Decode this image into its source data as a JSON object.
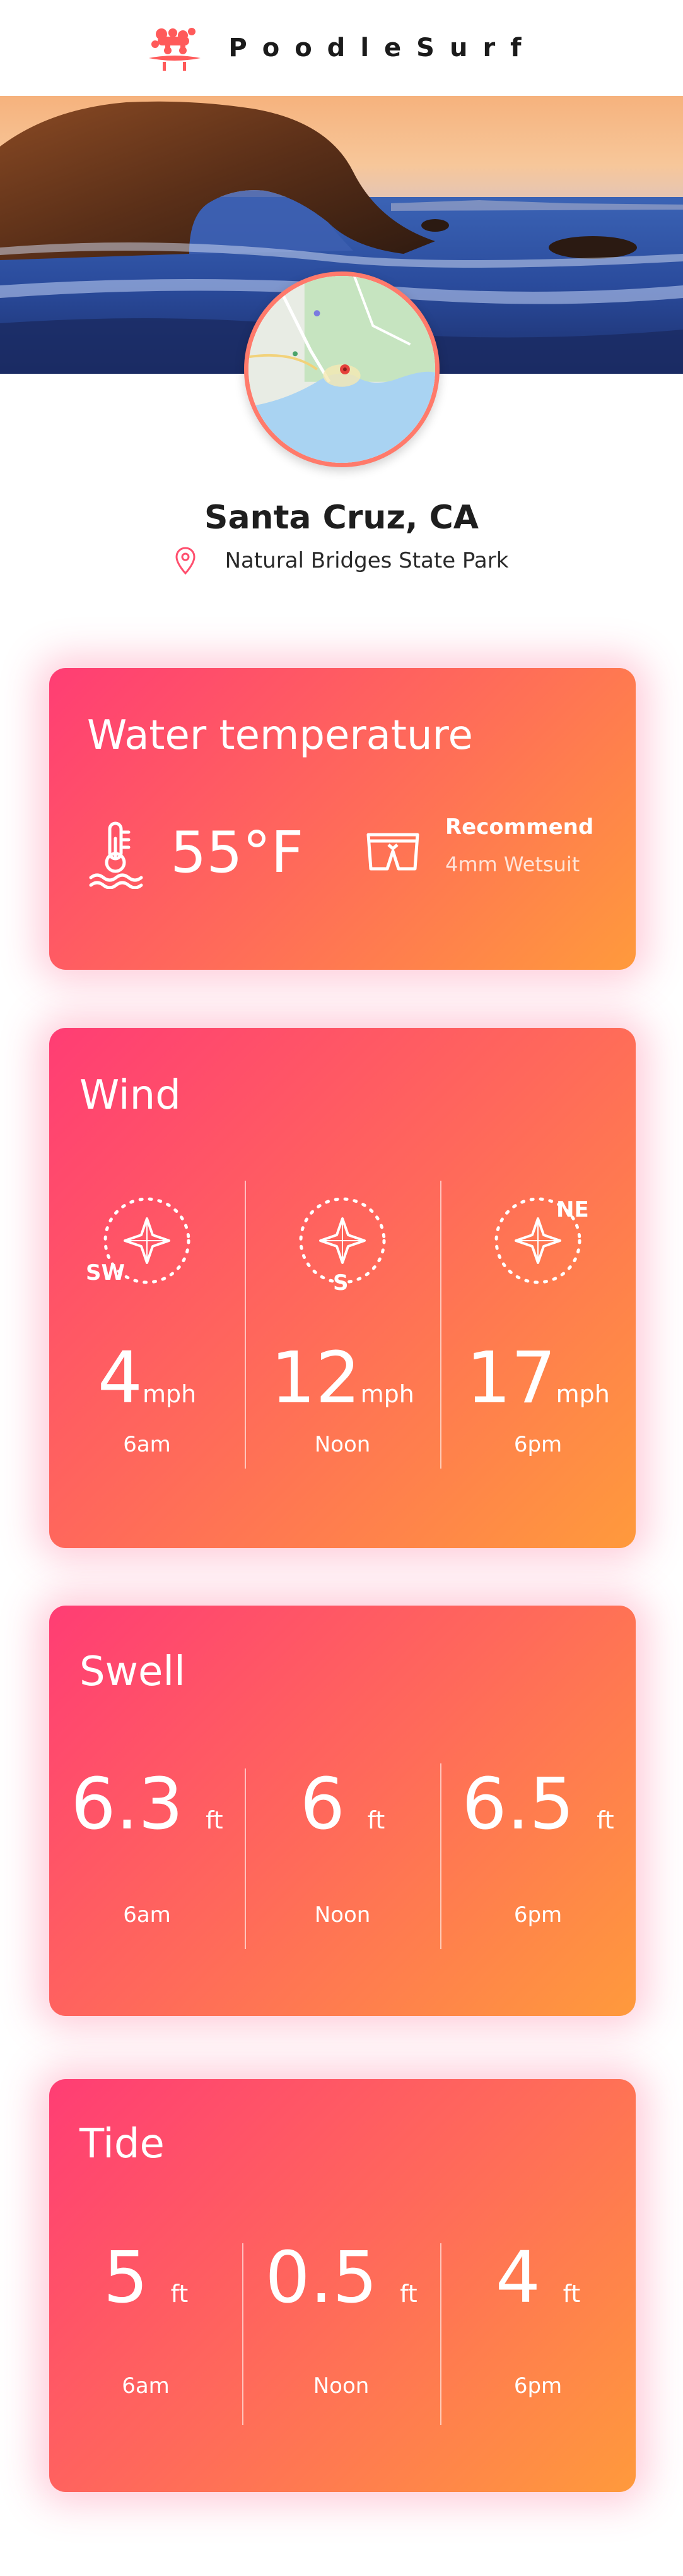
{
  "header": {
    "brand": "PoodleSurf",
    "logo_icon": "poodle-surfboard-icon"
  },
  "location": {
    "city": "Santa Cruz, CA",
    "spot": "Natural Bridges State Park",
    "pin_icon": "location-pin-icon"
  },
  "water": {
    "title": "Water temperature",
    "temperature": "55°F",
    "recommend_label": "Recommend",
    "recommend_value": "4mm Wetsuit"
  },
  "wind": {
    "title": "Wind",
    "readings": [
      {
        "direction": "SW",
        "speed": "4",
        "unit": "mph",
        "time": "6am"
      },
      {
        "direction": "S",
        "speed": "12",
        "unit": "mph",
        "time": "Noon"
      },
      {
        "direction": "NE",
        "speed": "17",
        "unit": "mph",
        "time": "6pm"
      }
    ]
  },
  "swell": {
    "title": "Swell",
    "readings": [
      {
        "height": "6.3",
        "unit": "ft",
        "time": "6am"
      },
      {
        "height": "6",
        "unit": "ft",
        "time": "Noon"
      },
      {
        "height": "6.5",
        "unit": "ft",
        "time": "6pm"
      }
    ]
  },
  "tide": {
    "title": "Tide",
    "readings": [
      {
        "height": "5",
        "unit": "ft",
        "time": "6am"
      },
      {
        "height": "0.5",
        "unit": "ft",
        "time": "Noon"
      },
      {
        "height": "4",
        "unit": "ft",
        "time": "6pm"
      }
    ]
  },
  "colors": {
    "accent": "#ff4f6e",
    "gradient_start": "#ff3d74",
    "gradient_end": "#ff9a3c",
    "map_border": "#ff7a6b"
  }
}
